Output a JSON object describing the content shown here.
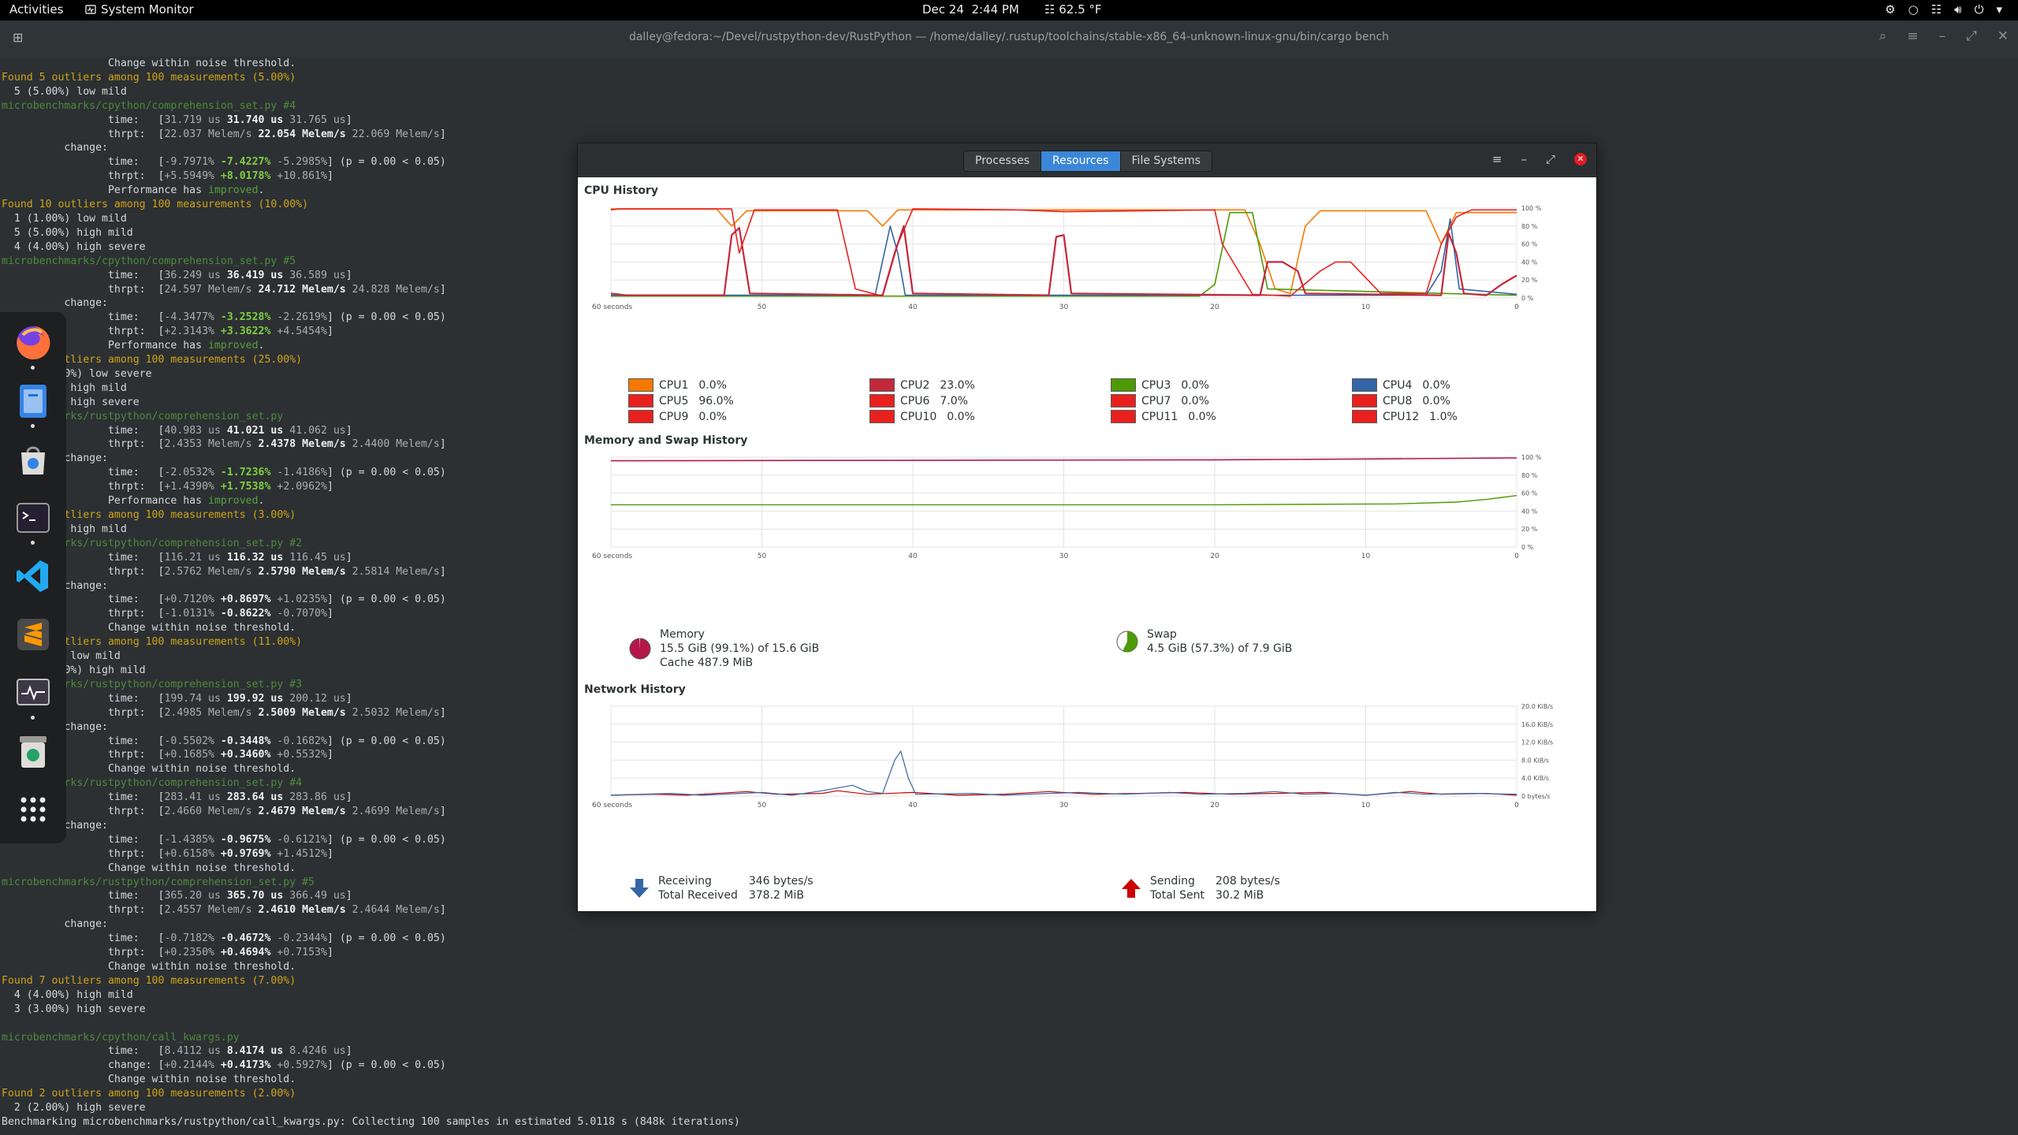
{
  "topbar": {
    "activities": "Activities",
    "app_name": "System Monitor",
    "date": "Dec 24",
    "time": "2:44 PM",
    "weather": "62.5 °F"
  },
  "terminal": {
    "title": "dalley@fedora:~/Devel/rustpython-dev/RustPython — /home/dalley/.rustup/toolchains/stable-x86_64-unknown-linux-gnu/bin/cargo bench",
    "lines": [
      "                 Change within noise threshold.",
      "Found 5 outliers among 100 measurements (5.00%)",
      "  5 (5.00%) low mild",
      "microbenchmarks/cpython/comprehension_set.py #4",
      "                 time:   [31.719 us 31.740 us 31.765 us]",
      "                 thrpt:  [22.037 Melem/s 22.054 Melem/s 22.069 Melem/s]",
      "          change:",
      "                 time:   [-9.7971% -7.4227% -5.2985%] (p = 0.00 < 0.05)",
      "                 thrpt:  [+5.5949% +8.0178% +10.861%]",
      "                 Performance has improved.",
      "Found 10 outliers among 100 measurements (10.00%)",
      "  1 (1.00%) low mild",
      "  5 (5.00%) high mild",
      "  4 (4.00%) high severe",
      "microbenchmarks/cpython/comprehension_set.py #5",
      "                 time:   [36.249 us 36.419 us 36.589 us]",
      "                 thrpt:  [24.597 Melem/s 24.712 Melem/s 24.828 Melem/s]",
      "          change:",
      "                 time:   [-4.3477% -3.2528% -2.2619%] (p = 0.00 < 0.05)",
      "                 thrpt:  [+2.3143% +3.3622% +4.5454%]",
      "                 Performance has improved.",
      "        outliers among 100 measurements (25.00%)",
      "  22 (22.00%) low severe",
      "        %) high mild",
      "        %) high severe",
      "        marks/rustpython/comprehension_set.py",
      "                 time:   [40.983 us 41.021 us 41.062 us]",
      "                 thrpt:  [2.4353 Melem/s 2.4378 Melem/s 2.4400 Melem/s]",
      "          change:",
      "                 time:   [-2.0532% -1.7236% -1.4186%] (p = 0.00 < 0.05)",
      "                 thrpt:  [+1.4390% +1.7538% +2.0962%]",
      "                 Performance has improved.",
      "        outliers among 100 measurements (3.00%)",
      "        %) high mild",
      "        marks/rustpython/comprehension_set.py #2",
      "                 time:   [116.21 us 116.32 us 116.45 us]",
      "                 thrpt:  [2.5762 Melem/s 2.5790 Melem/s 2.5814 Melem/s]",
      "          change:",
      "                 time:   [+0.7120% +0.8697% +1.0235%] (p = 0.00 < 0.05)",
      "                 thrpt:  [-1.0131% -0.8622% -0.7070%]",
      "                 Change within noise threshold.",
      "        outliers among 100 measurements (11.00%)",
      "        %) low mild",
      "  10 (10.00%) high mild",
      "        marks/rustpython/comprehension_set.py #3",
      "                 time:   [199.74 us 199.92 us 200.12 us]",
      "                 thrpt:  [2.4985 Melem/s 2.5009 Melem/s 2.5032 Melem/s]",
      "          change:",
      "                 time:   [-0.5502% -0.3448% -0.1682%] (p = 0.00 < 0.05)",
      "                 thrpt:  [+0.1685% +0.3460% +0.5532%]",
      "                 Change within noise threshold.",
      "        marks/rustpython/comprehension_set.py #4",
      "                 time:   [283.41 us 283.64 us 283.86 us]",
      "                 thrpt:  [2.4660 Melem/s 2.4679 Melem/s 2.4699 Melem/s]",
      "          change:",
      "                 time:   [-1.4385% -0.9675% -0.6121%] (p = 0.00 < 0.05)",
      "                 thrpt:  [+0.6158% +0.9769% +1.4512%]",
      "                 Change within noise threshold.",
      "microbenchmarks/rustpython/comprehension_set.py #5",
      "                 time:   [365.20 us 365.70 us 366.49 us]",
      "                 thrpt:  [2.4557 Melem/s 2.4610 Melem/s 2.4644 Melem/s]",
      "          change:",
      "                 time:   [-0.7182% -0.4672% -0.2344%] (p = 0.00 < 0.05)",
      "                 thrpt:  [+0.2350% +0.4694% +0.7153%]",
      "                 Change within noise threshold.",
      "Found 7 outliers among 100 measurements (7.00%)",
      "  4 (4.00%) high mild",
      "  3 (3.00%) high severe",
      "",
      "microbenchmarks/cpython/call_kwargs.py",
      "                 time:   [8.4112 us 8.4174 us 8.4246 us]",
      "                 change: [+0.2144% +0.4173% +0.5927%] (p = 0.00 < 0.05)",
      "                 Change within noise threshold.",
      "Found 2 outliers among 100 measurements (2.00%)",
      "  2 (2.00%) high severe",
      "Benchmarking microbenchmarks/rustpython/call_kwargs.py: Collecting 100 samples in estimated 5.0118 s (848k iterations)"
    ]
  },
  "dock": {
    "apps": [
      {
        "name": "firefox-icon",
        "running": true
      },
      {
        "name": "files-icon",
        "running": true
      },
      {
        "name": "software-icon",
        "running": false
      },
      {
        "name": "terminal-icon",
        "running": true
      },
      {
        "name": "vscode-icon",
        "running": false
      },
      {
        "name": "sublime-text-icon",
        "running": false
      },
      {
        "name": "system-monitor-icon",
        "running": true
      },
      {
        "name": "trash-icon",
        "running": false
      },
      {
        "name": "app-grid-icon",
        "running": false
      }
    ]
  },
  "sysmon": {
    "tabs": [
      {
        "label": "Processes",
        "active": false
      },
      {
        "label": "Resources",
        "active": true
      },
      {
        "label": "File Systems",
        "active": false
      }
    ],
    "cpu": {
      "title": "CPU History",
      "x_labels": [
        "60 seconds",
        "50",
        "40",
        "30",
        "20",
        "10",
        "0"
      ],
      "y_labels": [
        "100 %",
        "80 %",
        "60 %",
        "40 %",
        "20 %",
        "0 %"
      ],
      "cpus": [
        {
          "label": "CPU1",
          "value": "0.0%",
          "color": "#f57900"
        },
        {
          "label": "CPU2",
          "value": "23.0%",
          "color": "#c3283c"
        },
        {
          "label": "CPU3",
          "value": "0.0%",
          "color": "#4e9a06"
        },
        {
          "label": "CPU4",
          "value": "0.0%",
          "color": "#3465a4"
        },
        {
          "label": "CPU5",
          "value": "96.0%",
          "color": "#e8211f"
        },
        {
          "label": "CPU6",
          "value": "7.0%",
          "color": "#e8211f"
        },
        {
          "label": "CPU7",
          "value": "0.0%",
          "color": "#e8211f"
        },
        {
          "label": "CPU8",
          "value": "0.0%",
          "color": "#e8211f"
        },
        {
          "label": "CPU9",
          "value": "0.0%",
          "color": "#e8211f"
        },
        {
          "label": "CPU10",
          "value": "0.0%",
          "color": "#e8211f"
        },
        {
          "label": "CPU11",
          "value": "0.0%",
          "color": "#e8211f"
        },
        {
          "label": "CPU12",
          "value": "1.0%",
          "color": "#e8211f"
        }
      ]
    },
    "memory": {
      "title": "Memory and Swap History",
      "x_labels": [
        "60 seconds",
        "50",
        "40",
        "30",
        "20",
        "10",
        "0"
      ],
      "y_labels": [
        "100 %",
        "80 %",
        "60 %",
        "40 %",
        "20 %",
        "0 %"
      ],
      "mem_label": "Memory",
      "mem_used": "15.5 GiB (99.1%) of 15.6 GiB",
      "mem_cache": "Cache 487.9 MiB",
      "mem_percent": 99.1,
      "swap_label": "Swap",
      "swap_used": "4.5 GiB (57.3%) of 7.9 GiB",
      "swap_percent": 57.3,
      "mem_color": "#b5174b",
      "swap_color": "#4e9a06"
    },
    "network": {
      "title": "Network History",
      "x_labels": [
        "60 seconds",
        "50",
        "40",
        "30",
        "20",
        "10",
        "0"
      ],
      "y_labels": [
        "20.0 KiB/s",
        "16.0 KiB/s",
        "12.0 KiB/s",
        "8.0 KiB/s",
        "4.0 KiB/s",
        "0 bytes/s"
      ],
      "receiving_label": "Receiving",
      "receiving_value": "346 bytes/s",
      "total_received_label": "Total Received",
      "total_received_value": "378.2 MiB",
      "sending_label": "Sending",
      "sending_value": "208 bytes/s",
      "total_sent_label": "Total Sent",
      "total_sent_value": "30.2 MiB",
      "recv_color": "#3465a4",
      "send_color": "#cc0000"
    }
  }
}
